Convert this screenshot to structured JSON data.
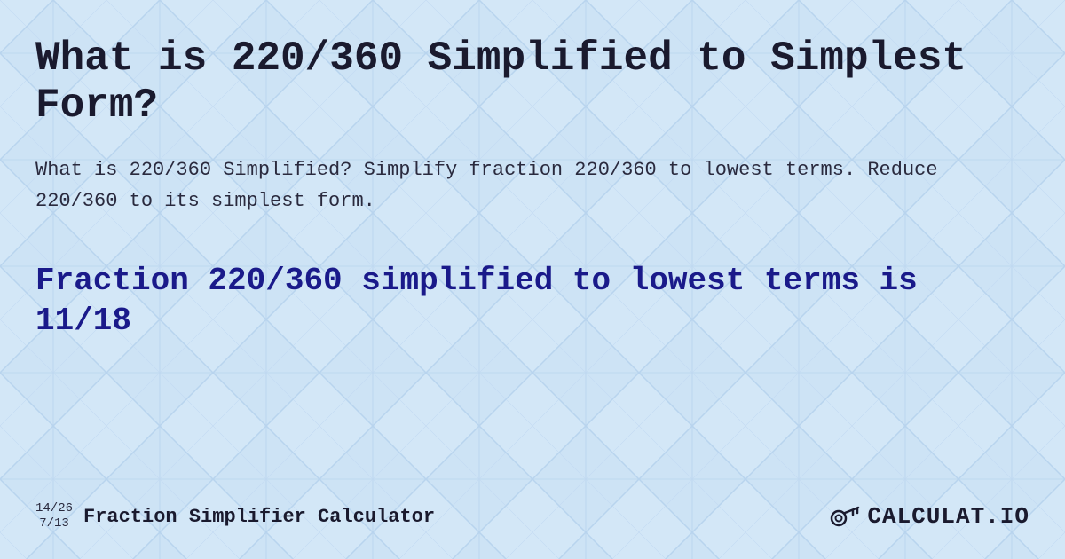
{
  "page": {
    "background_color": "#cce0f5",
    "title": "What is 220/360 Simplified to Simplest Form?",
    "description": "What is 220/360 Simplified? Simplify fraction 220/360 to lowest terms. Reduce 220/360 to its simplest form.",
    "result_label": "Fraction 220/360 simplified to lowest terms is 11/18",
    "footer": {
      "fraction_top": "14/26",
      "fraction_bottom": "7/13",
      "brand_name": "Fraction Simplifier Calculator",
      "logo_text": "CALCULAT.IO"
    }
  }
}
